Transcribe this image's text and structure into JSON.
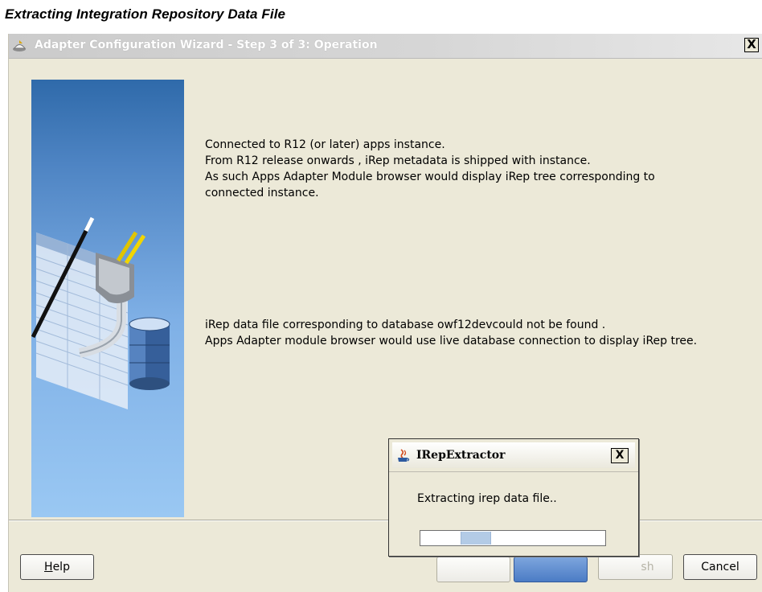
{
  "caption": "Extracting Integration Repository Data File",
  "window": {
    "title": "Adapter Configuration Wizard - Step 3 of 3: Operation",
    "close_glyph": "X",
    "icons": [
      "wizard-icon",
      "close-icon"
    ]
  },
  "message_block_1": [
    "Connected to R12 (or later) apps instance.",
    "From R12 release onwards , iRep metadata is shipped with instance.",
    "As such Apps Adapter Module browser would display iRep tree corresponding to",
    "connected instance."
  ],
  "message_block_2": [
    "iRep data file corresponding to database owf12devcould not be found .",
    "Apps Adapter module browser would use live database connection to display iRep tree."
  ],
  "buttons": {
    "help_prefix": "",
    "help_mnemonic": "H",
    "help_rest": "elp",
    "finish_partial": "sh",
    "cancel": "Cancel"
  },
  "dialog": {
    "title": "IRepExtractor",
    "close_glyph": "X",
    "message": "Extracting irep data file..",
    "progress_indeterminate": true
  },
  "colors": {
    "panel_bg": "#ece9d8",
    "side_image_top": "#2f6aaa",
    "side_image_bottom": "#9ac8f3",
    "progress_fill": "#b3cbe6"
  }
}
